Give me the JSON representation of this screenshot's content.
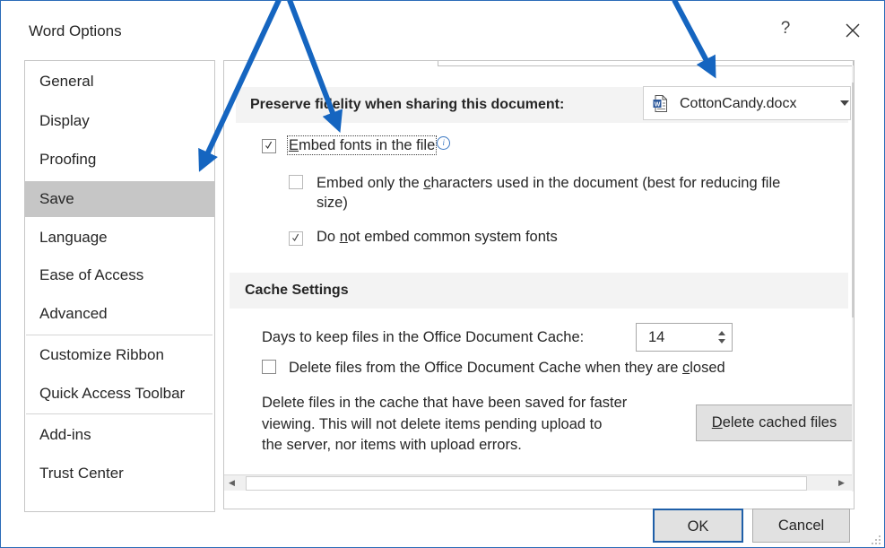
{
  "window": {
    "title": "Word Options",
    "help_label": "?",
    "close_icon": "close-icon"
  },
  "nav": {
    "items": [
      {
        "label": "General"
      },
      {
        "label": "Display"
      },
      {
        "label": "Proofing"
      },
      {
        "label": "Save",
        "selected": true
      },
      {
        "label": "Language"
      },
      {
        "label": "Ease of Access"
      },
      {
        "label": "Advanced"
      },
      {
        "label": "Customize Ribbon"
      },
      {
        "label": "Quick Access Toolbar"
      },
      {
        "label": "Add-ins"
      },
      {
        "label": "Trust Center"
      }
    ]
  },
  "fidelity": {
    "header": "Preserve fidelity when sharing this document:",
    "document": "CottonCandy.docx",
    "document_icon": "word-doc-icon",
    "embed_fonts": {
      "label_first": "E",
      "label_rest": "mbed fonts in the file",
      "checked": true
    },
    "embed_only": {
      "line1_pre": "Embed only the ",
      "line1_u": "c",
      "line1_post": "haracters used in the document (best for reducing file",
      "line2": "size)",
      "checked": false,
      "enabled": false
    },
    "no_common": {
      "label_pre": "Do ",
      "label_u": "n",
      "label_post": "ot embed common system fonts",
      "checked": true,
      "enabled": false
    }
  },
  "cache": {
    "header": "Cache Settings",
    "days_label": "Days to keep files in the Office Document Cache:",
    "days_value": "14",
    "delete_on_close": {
      "label_pre": "Delete files from the Office Document Cache when they are ",
      "label_u": "c",
      "label_post": "losed",
      "checked": false
    },
    "description": [
      "Delete files in the cache that have been saved for faster",
      "viewing. This will not delete items pending upload to",
      "the server, nor items with upload errors."
    ],
    "delete_button": {
      "first": "D",
      "rest": "elete cached files"
    }
  },
  "footer": {
    "ok": "OK",
    "cancel": "Cancel"
  },
  "colors": {
    "selected_nav": "#c6c6c6",
    "section_header": "#f3f3f3",
    "annotation_arrow": "#1565c0",
    "ok_border": "#1f5fa8"
  }
}
